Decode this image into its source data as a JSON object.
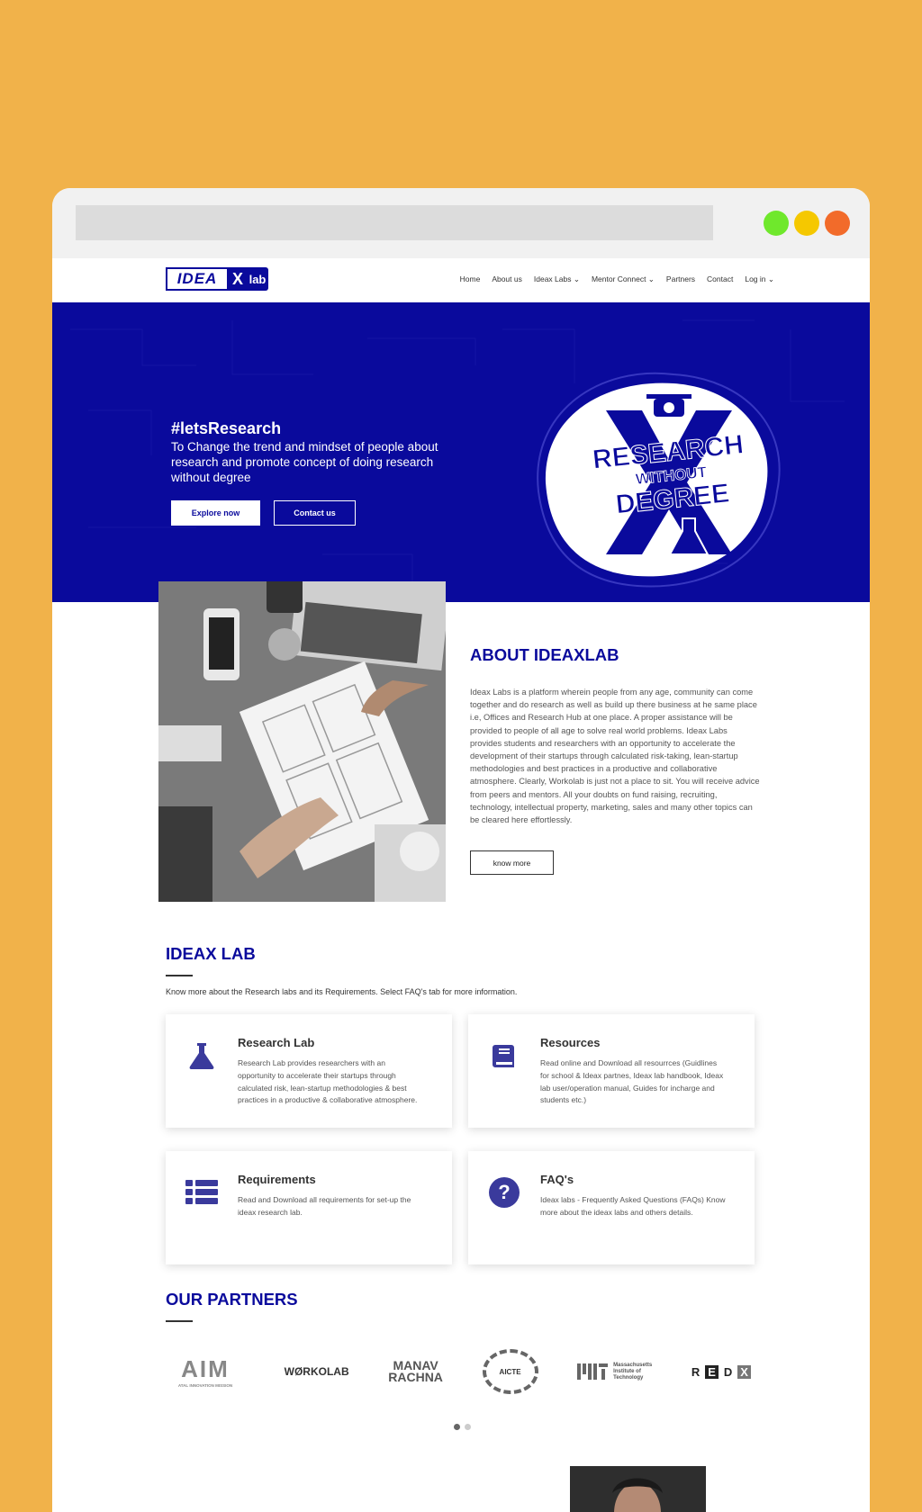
{
  "colors": {
    "background": "#F1B24A",
    "brand": "#0a0a9c",
    "dot_green": "#6fe82c",
    "dot_yellow": "#f5c800",
    "dot_red": "#f26b2a"
  },
  "logo": {
    "part1": "IDEA",
    "part2": "X",
    "part3": "lab"
  },
  "nav": {
    "items": [
      "Home",
      "About us",
      "Ideax Labs ⌄",
      "Mentor Connect ⌄",
      "Partners",
      "Contact",
      "Log in ⌄"
    ]
  },
  "hero": {
    "tag": "#letsResearch",
    "subtitle": "To Change the trend and mindset of people about research and promote concept of doing research without degree",
    "explore_label": "Explore now",
    "contact_label": "Contact us",
    "badge_line1": "RESEARCH",
    "badge_line2": "WITHOUT",
    "badge_line3": "DEGREE"
  },
  "about": {
    "title": "ABOUT IDEAXLAB",
    "text": "Ideax Labs is a platform wherein people from any age, community can come together and do research as well as build up there business at he same place i.e, Offices and Research Hub at one place. A proper assistance will be provided to people of all age to solve real world problems. Ideax Labs provides students and researchers with an opportunity to accelerate the development of their startups through calculated risk-taking, lean-startup methodologies and best practices in a productive and collaborative atmosphere. Clearly, Workolab is just not a place to sit. You will receive advice from peers and mentors. All your doubts on fund raising, recruiting, technology, intellectual property, marketing, sales and many other topics can be cleared here effortlessly.",
    "button": "know more"
  },
  "ideax": {
    "title": "IDEAX LAB",
    "desc": "Know more about the Research labs and its Requirements. Select FAQ's tab for more information.",
    "cards": [
      {
        "title": "Research Lab",
        "desc": "Research Lab provides researchers with an opportunity to accelerate their startups through calculated risk, lean-startup methodologies & best practices in a productive & collaborative atmosphere.",
        "icon": "flask-icon"
      },
      {
        "title": "Resources",
        "desc": "Read online and Download all resourrces (Guidlines for school & Ideax partnes, Ideax lab handbook, Ideax lab user/operation manual, Guides for incharge and students etc.)",
        "icon": "book-icon"
      },
      {
        "title": "Requirements",
        "desc": "Read and Download all requirements for set-up the ideax research lab.",
        "icon": "list-icon"
      },
      {
        "title": "FAQ's",
        "desc": "Ideax labs - Frequently Asked Questions (FAQs) Know more about the ideax labs and others details.",
        "icon": "question-icon"
      }
    ]
  },
  "partners": {
    "title": "OUR PARTNERS",
    "logos": [
      "AIM",
      "ATAL INNOVATION MISSION",
      "WØRKOLAB",
      "MANAV",
      "RACHNA",
      "AICTE",
      "Massachusetts",
      "Institute of",
      "Technology",
      "R",
      "E",
      "D",
      "X"
    ]
  }
}
